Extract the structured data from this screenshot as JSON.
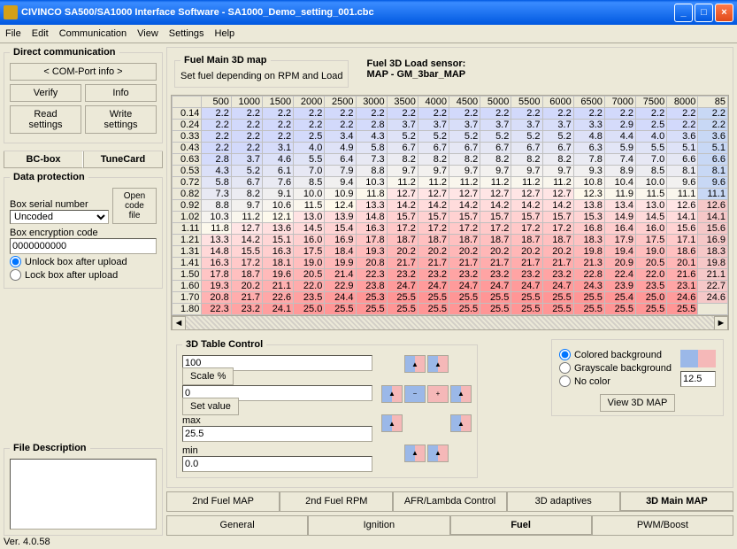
{
  "window": {
    "title": "CIVINCO SA500/SA1000 Interface Software - SA1000_Demo_setting_001.cbc"
  },
  "menu": [
    "File",
    "Edit",
    "Communication",
    "View",
    "Settings",
    "Help"
  ],
  "directcomm": {
    "legend": "Direct communication",
    "comport": "< COM-Port info >",
    "verify": "Verify",
    "info": "Info",
    "read": "Read settings",
    "write": "Write settings",
    "bcbox": "BC-box",
    "tunecard": "TuneCard"
  },
  "dataprot": {
    "legend": "Data protection",
    "serial_label": "Box serial number",
    "open_file": "Open code file",
    "serial_value": "Uncoded",
    "enc_label": "Box encryption code",
    "enc_value": "0000000000",
    "unlock": "Unlock box after upload",
    "lock": "Lock box after upload"
  },
  "filedesc": {
    "legend": "File Description"
  },
  "map": {
    "legend": "Fuel Main 3D map",
    "desc": "Set fuel depending on RPM and Load",
    "loadsensor_label": "Fuel 3D Load sensor:",
    "loadsensor_value": "MAP - GM_3bar_MAP"
  },
  "chart_data": {
    "type": "heatmap",
    "title": "Fuel Main 3D map",
    "xlabel": "RPM",
    "ylabel": "Load",
    "x_headers": [
      "500",
      "1000",
      "1500",
      "2000",
      "2500",
      "3000",
      "3500",
      "4000",
      "4500",
      "5000",
      "5500",
      "6000",
      "6500",
      "7000",
      "7500",
      "8000"
    ],
    "y_headers": [
      "0.14",
      "0.24",
      "0.33",
      "0.43",
      "0.63",
      "0.53",
      "0.72",
      "0.82",
      "0.92",
      "1.02",
      "1.11",
      "1.21",
      "1.31",
      "1.41",
      "1.50",
      "1.60",
      "1.70",
      "1.80"
    ],
    "rightcol": [
      "85",
      "2.2",
      "2.2",
      "3.6",
      "5.1",
      "6.6",
      "8.1",
      "9.6",
      "11.1",
      "12.6",
      "14.1",
      "15.6",
      "16.9",
      "18.3",
      "19.8",
      "21.1",
      "22.7",
      "24.6",
      ""
    ],
    "values": [
      [
        2.2,
        2.2,
        2.2,
        2.2,
        2.2,
        2.2,
        2.2,
        2.2,
        2.2,
        2.2,
        2.2,
        2.2,
        2.2,
        2.2,
        2.2,
        2.2
      ],
      [
        2.2,
        2.2,
        2.2,
        2.2,
        2.2,
        2.8,
        3.7,
        3.7,
        3.7,
        3.7,
        3.7,
        3.7,
        3.3,
        2.9,
        2.5,
        2.2
      ],
      [
        2.2,
        2.2,
        2.2,
        2.5,
        3.4,
        4.3,
        5.2,
        5.2,
        5.2,
        5.2,
        5.2,
        5.2,
        4.8,
        4.4,
        4.0,
        3.6
      ],
      [
        2.2,
        2.2,
        3.1,
        4.0,
        4.9,
        5.8,
        6.7,
        6.7,
        6.7,
        6.7,
        6.7,
        6.7,
        6.3,
        5.9,
        5.5,
        5.1
      ],
      [
        2.8,
        3.7,
        4.6,
        5.5,
        6.4,
        7.3,
        8.2,
        8.2,
        8.2,
        8.2,
        8.2,
        8.2,
        7.8,
        7.4,
        7.0,
        6.6
      ],
      [
        4.3,
        5.2,
        6.1,
        7.0,
        7.9,
        8.8,
        9.7,
        9.7,
        9.7,
        9.7,
        9.7,
        9.7,
        9.3,
        8.9,
        8.5,
        8.1
      ],
      [
        5.8,
        6.7,
        7.6,
        8.5,
        9.4,
        10.3,
        11.2,
        11.2,
        11.2,
        11.2,
        11.2,
        11.2,
        10.8,
        10.4,
        10.0,
        9.6
      ],
      [
        7.3,
        8.2,
        9.1,
        10.0,
        10.9,
        11.8,
        12.7,
        12.7,
        12.7,
        12.7,
        12.7,
        12.7,
        12.3,
        11.9,
        11.5,
        11.1
      ],
      [
        8.8,
        9.7,
        10.6,
        11.5,
        12.4,
        13.3,
        14.2,
        14.2,
        14.2,
        14.2,
        14.2,
        14.2,
        13.8,
        13.4,
        13.0,
        12.6
      ],
      [
        10.3,
        11.2,
        12.1,
        13.0,
        13.9,
        14.8,
        15.7,
        15.7,
        15.7,
        15.7,
        15.7,
        15.7,
        15.3,
        14.9,
        14.5,
        14.1
      ],
      [
        11.8,
        12.7,
        13.6,
        14.5,
        15.4,
        16.3,
        17.2,
        17.2,
        17.2,
        17.2,
        17.2,
        17.2,
        16.8,
        16.4,
        16.0,
        15.6
      ],
      [
        13.3,
        14.2,
        15.1,
        16.0,
        16.9,
        17.8,
        18.7,
        18.7,
        18.7,
        18.7,
        18.7,
        18.7,
        18.3,
        17.9,
        17.5,
        17.1
      ],
      [
        14.8,
        15.5,
        16.3,
        17.5,
        18.4,
        19.3,
        20.2,
        20.2,
        20.2,
        20.2,
        20.2,
        20.2,
        19.8,
        19.4,
        19.0,
        18.6
      ],
      [
        16.3,
        17.2,
        18.1,
        19.0,
        19.9,
        20.8,
        21.7,
        21.7,
        21.7,
        21.7,
        21.7,
        21.7,
        21.3,
        20.9,
        20.5,
        20.1
      ],
      [
        17.8,
        18.7,
        19.6,
        20.5,
        21.4,
        22.3,
        23.2,
        23.2,
        23.2,
        23.2,
        23.2,
        23.2,
        22.8,
        22.4,
        22.0,
        21.6
      ],
      [
        19.3,
        20.2,
        21.1,
        22.0,
        22.9,
        23.8,
        24.7,
        24.7,
        24.7,
        24.7,
        24.7,
        24.7,
        24.3,
        23.9,
        23.5,
        23.1
      ],
      [
        20.8,
        21.7,
        22.6,
        23.5,
        24.4,
        25.3,
        25.5,
        25.5,
        25.5,
        25.5,
        25.5,
        25.5,
        25.5,
        25.4,
        25.0,
        24.6
      ],
      [
        22.3,
        23.2,
        24.1,
        25.0,
        25.5,
        25.5,
        25.5,
        25.5,
        25.5,
        25.5,
        25.5,
        25.5,
        25.5,
        25.5,
        25.5,
        25.5
      ]
    ]
  },
  "control3d": {
    "legend": "3D Table Control",
    "scale_value": "100",
    "scale_btn": "Scale %",
    "setval_value": "0",
    "setval_btn": "Set value",
    "max_label": "max",
    "max_value": "25.5",
    "min_label": "min",
    "min_value": "0.0"
  },
  "bgopts": {
    "colored": "Colored background",
    "grayscale": "Grayscale background",
    "nocolor": "No color",
    "threshold": "12.5",
    "view3d": "View 3D MAP"
  },
  "tabs_upper": [
    "2nd Fuel MAP",
    "2nd Fuel RPM",
    "AFR/Lambda Control",
    "3D adaptives",
    "3D Main MAP"
  ],
  "tabs_lower": [
    "General",
    "Ignition",
    "Fuel",
    "PWM/Boost"
  ],
  "version": "Ver. 4.0.58"
}
